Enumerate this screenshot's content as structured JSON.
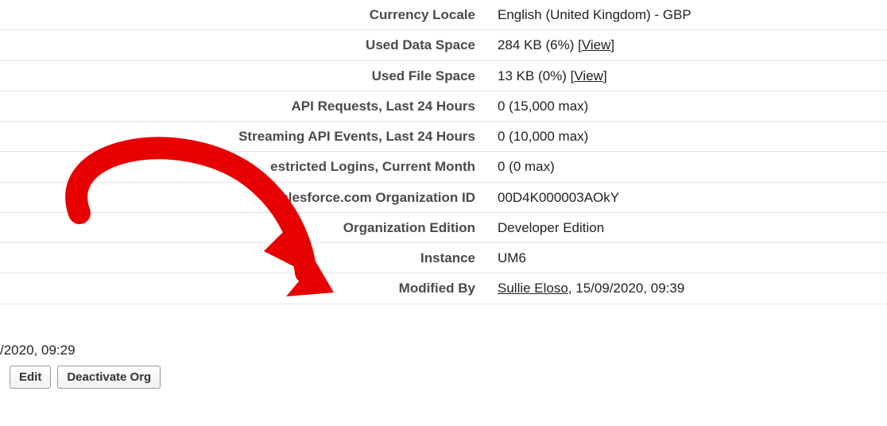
{
  "rows": {
    "currency_locale": {
      "label": "Currency Locale",
      "value": "English (United Kingdom) - GBP"
    },
    "used_data_space": {
      "label": "Used Data Space",
      "value": "284 KB (6%) ",
      "link": "View"
    },
    "used_file_space": {
      "label": "Used File Space",
      "value": "13 KB (0%) ",
      "link": "View"
    },
    "api_requests": {
      "label": "API Requests, Last 24 Hours",
      "value": "0 (15,000 max)"
    },
    "streaming_events": {
      "label": "Streaming API Events, Last 24 Hours",
      "value": "0 (10,000 max)"
    },
    "restricted_logins": {
      "label": "estricted Logins, Current Month",
      "value": "0 (0 max)"
    },
    "org_id": {
      "label": "Salesforce.com Organization ID",
      "value": "00D4K000003AOkY"
    },
    "org_edition": {
      "label": "Organization Edition",
      "value": "Developer Edition"
    },
    "instance": {
      "label": "Instance",
      "value": "UM6"
    },
    "modified_by": {
      "label": "Modified By",
      "person": "Sullie Eloso",
      "rest": ", 15/09/2020, 09:39"
    }
  },
  "left_partial_date": "/2020, 09:29",
  "buttons": {
    "edit": "Edit",
    "deactivate": "Deactivate Org"
  },
  "bracket_open": "[",
  "bracket_close": "]"
}
